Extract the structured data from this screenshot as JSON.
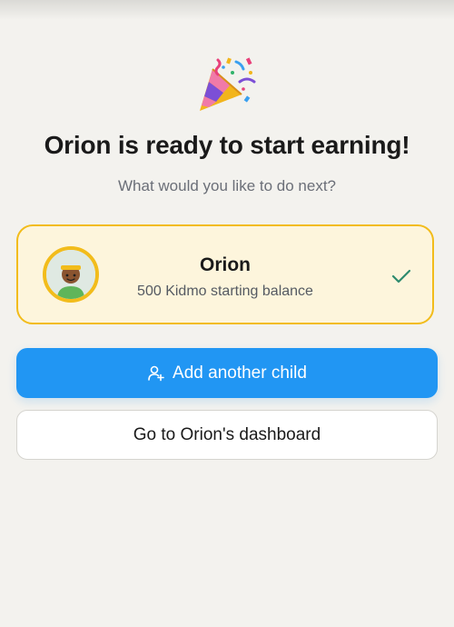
{
  "header": {
    "icon": "party-popper-icon",
    "title": "Orion is ready to start earning!",
    "subtitle": "What would you like to do next?"
  },
  "child_card": {
    "name": "Orion",
    "balance_text": "500 Kidmo starting balance",
    "avatar_icon": "child-avatar-icon",
    "status_icon": "checkmark-icon",
    "accent_color": "#f2bc1b",
    "background_color": "#fdf5dc"
  },
  "actions": {
    "add_child_label": "Add another child",
    "add_child_icon": "add-user-icon",
    "add_child_color": "#2196f3",
    "dashboard_label": "Go to Orion's dashboard"
  }
}
